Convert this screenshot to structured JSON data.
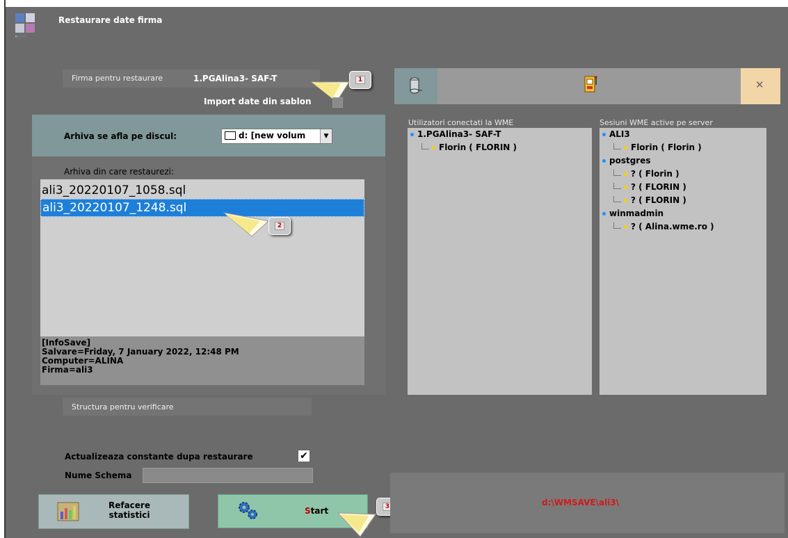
{
  "title": "Restaurare date firma",
  "firma": {
    "label": "Firma pentru restaurare",
    "value": "1.PGAlina3- SAF-T"
  },
  "import_label": "Import date din sablon",
  "callouts": [
    "1",
    "2",
    "3"
  ],
  "arhiva_disc": {
    "label": "Arhiva se afla pe discul:",
    "value": "d: [new volum"
  },
  "arhiva_label": "Arhiva din care restaurezi:",
  "files": [
    "ali3_20220107_1058.sql",
    "ali3_20220107_1248.sql"
  ],
  "selected_index": 1,
  "info": [
    "[InfoSave]",
    "Salvare=Friday, 7 January  2022, 12:48 PM",
    "Computer=ALINA",
    "Firma=ali3"
  ],
  "structura_label": "Structura pentru verificare",
  "actualizeaza": {
    "label": "Actualizeaza constante dupa restaurare",
    "checked": true,
    "mark": "✔"
  },
  "schema": {
    "label": "Nume Schema",
    "value": ""
  },
  "buttons": {
    "refacere": [
      "Refacere",
      "statistici"
    ],
    "start_s": "S",
    "start_rest": "tart"
  },
  "utilizatori": {
    "header": "Utilizatori conectati la WME",
    "items": [
      {
        "text": "1.PGAlina3- SAF-T",
        "level": 0
      },
      {
        "text": "Florin ( FLORIN )",
        "level": 1
      }
    ]
  },
  "sesiuni": {
    "header": "Sesiuni WME active pe server",
    "items": [
      {
        "text": "ALI3",
        "level": 0
      },
      {
        "text": "Florin ( Florin )",
        "level": 1
      },
      {
        "text": "postgres",
        "level": 0
      },
      {
        "text": "? ( Florin )",
        "level": 1
      },
      {
        "text": "? ( FLORIN )",
        "level": 1
      },
      {
        "text": "? ( FLORIN )",
        "level": 1
      },
      {
        "text": "winmadmin",
        "level": 0
      },
      {
        "text": "? ( Alina.wme.ro )",
        "level": 1
      }
    ]
  },
  "path": "d:\\WMSAVE\\ali3\\",
  "close_glyph": "✕",
  "dropdown_glyph": "▼",
  "colors": {
    "accent_red": "#c00000",
    "selection": "#1e7fd8",
    "teal_panel": "#80989a",
    "start_btn": "#8fc6a9"
  }
}
